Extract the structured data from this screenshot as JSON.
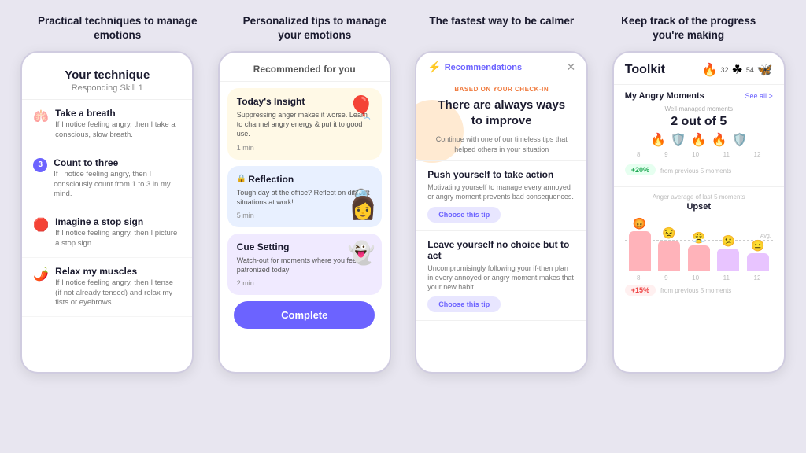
{
  "headers": [
    "Practical techniques to manage emotions",
    "Personalized tips to manage your emotions",
    "The fastest way to be calmer",
    "Keep track of the progress you're making"
  ],
  "phone1": {
    "title": "Your technique",
    "subtitle": "Responding Skill 1",
    "items": [
      {
        "icon": "🫁",
        "title": "Take a breath",
        "desc": "If I notice feeling angry, then I take a conscious, slow breath."
      },
      {
        "icon": "3",
        "title": "Count to three",
        "desc": "If I notice feeling angry, then I consciously count from 1 to 3 in my mind."
      },
      {
        "icon": "🛑",
        "title": "Imagine a stop sign",
        "desc": "If I notice feeling angry, then I picture a stop sign."
      },
      {
        "icon": "🌶️",
        "title": "Relax my muscles",
        "desc": "If I notice feeling angry, then I tense (if not already tensed) and relax my fists or eyebrows."
      }
    ]
  },
  "phone2": {
    "header": "Recommended for you",
    "cards": [
      {
        "title": "Today's Insight",
        "desc": "Suppressing anger makes it worse. Learn to channel angry energy & put it to good use.",
        "time": "1 min",
        "emoji": "🎈",
        "color": "yellow"
      },
      {
        "title": "Reflection",
        "desc": "Tough day at the office? Reflect on difficult situations at work!",
        "time": "5 min",
        "emoji": "🔍",
        "color": "blue"
      },
      {
        "title": "Cue Setting",
        "desc": "Watch-out for moments where you feel patronized today!",
        "time": "2 min",
        "emoji": "👻",
        "color": "purple"
      }
    ],
    "complete_btn": "Complete"
  },
  "phone3": {
    "topbar_label": "Recommendations",
    "based_label": "BASED ON YOUR CHECK-IN",
    "main_title": "There are always ways to improve",
    "main_desc": "Continue with one of our timeless tips that helped others in your situation",
    "tips": [
      {
        "title": "Push yourself to take action",
        "desc": "Motivating yourself to manage every annoyed or angry moment prevents bad consequences.",
        "btn": "Choose this tip"
      },
      {
        "title": "Leave yourself no choice but to act",
        "desc": "Uncompromisingly following your if-then plan in every annoyed or angry moment makes that your new habit.",
        "btn": "Choose this tip"
      }
    ]
  },
  "phone4": {
    "title": "Toolkit",
    "badge": "🔥 32 ☘ 54 🦋",
    "section_title": "My Angry Moments",
    "see_all": "See all >",
    "well_managed": "Well-managed moments",
    "count": "2 out of 5",
    "emojis": [
      "🔥",
      "🛡️",
      "🔥",
      "🔥",
      "🛡️"
    ],
    "dates": [
      "8",
      "9",
      "10",
      "11",
      "12"
    ],
    "change_green": "+20%",
    "from_green": "from previous 5 moments",
    "chart_label": "Anger average of last 5 moments",
    "angry_avg": "Upset",
    "chart_dates": [
      "8",
      "9",
      "10",
      "11",
      "12"
    ],
    "change_red": "+15%",
    "from_red": "from previous 5 moments"
  }
}
